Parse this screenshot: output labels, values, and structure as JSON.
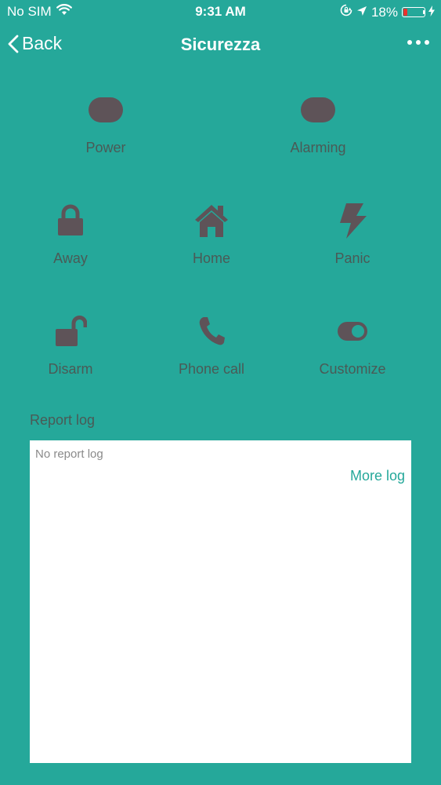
{
  "status_bar": {
    "carrier": "No SIM",
    "time": "9:31 AM",
    "battery_percent": "18%",
    "battery_level": 0.18,
    "battery_color": "#E8322E"
  },
  "nav": {
    "back_label": "Back",
    "title": "Sicurezza"
  },
  "controls": {
    "power": {
      "label": "Power",
      "icon": "toggle-pill-icon"
    },
    "alarming": {
      "label": "Alarming",
      "icon": "toggle-pill-icon"
    },
    "away": {
      "label": "Away",
      "icon": "lock-icon"
    },
    "home": {
      "label": "Home",
      "icon": "home-icon"
    },
    "panic": {
      "label": "Panic",
      "icon": "lightning-bolt-icon"
    },
    "disarm": {
      "label": "Disarm",
      "icon": "unlock-icon"
    },
    "phone_call": {
      "label": "Phone call",
      "icon": "phone-icon"
    },
    "customize": {
      "label": "Customize",
      "icon": "toggle-switch-icon"
    }
  },
  "report": {
    "title": "Report log",
    "empty_text": "No report log",
    "more_label": "More log"
  },
  "colors": {
    "background": "#25A89A",
    "icon": "#5E5358",
    "label": "#4A5A56",
    "link": "#25A89A"
  }
}
